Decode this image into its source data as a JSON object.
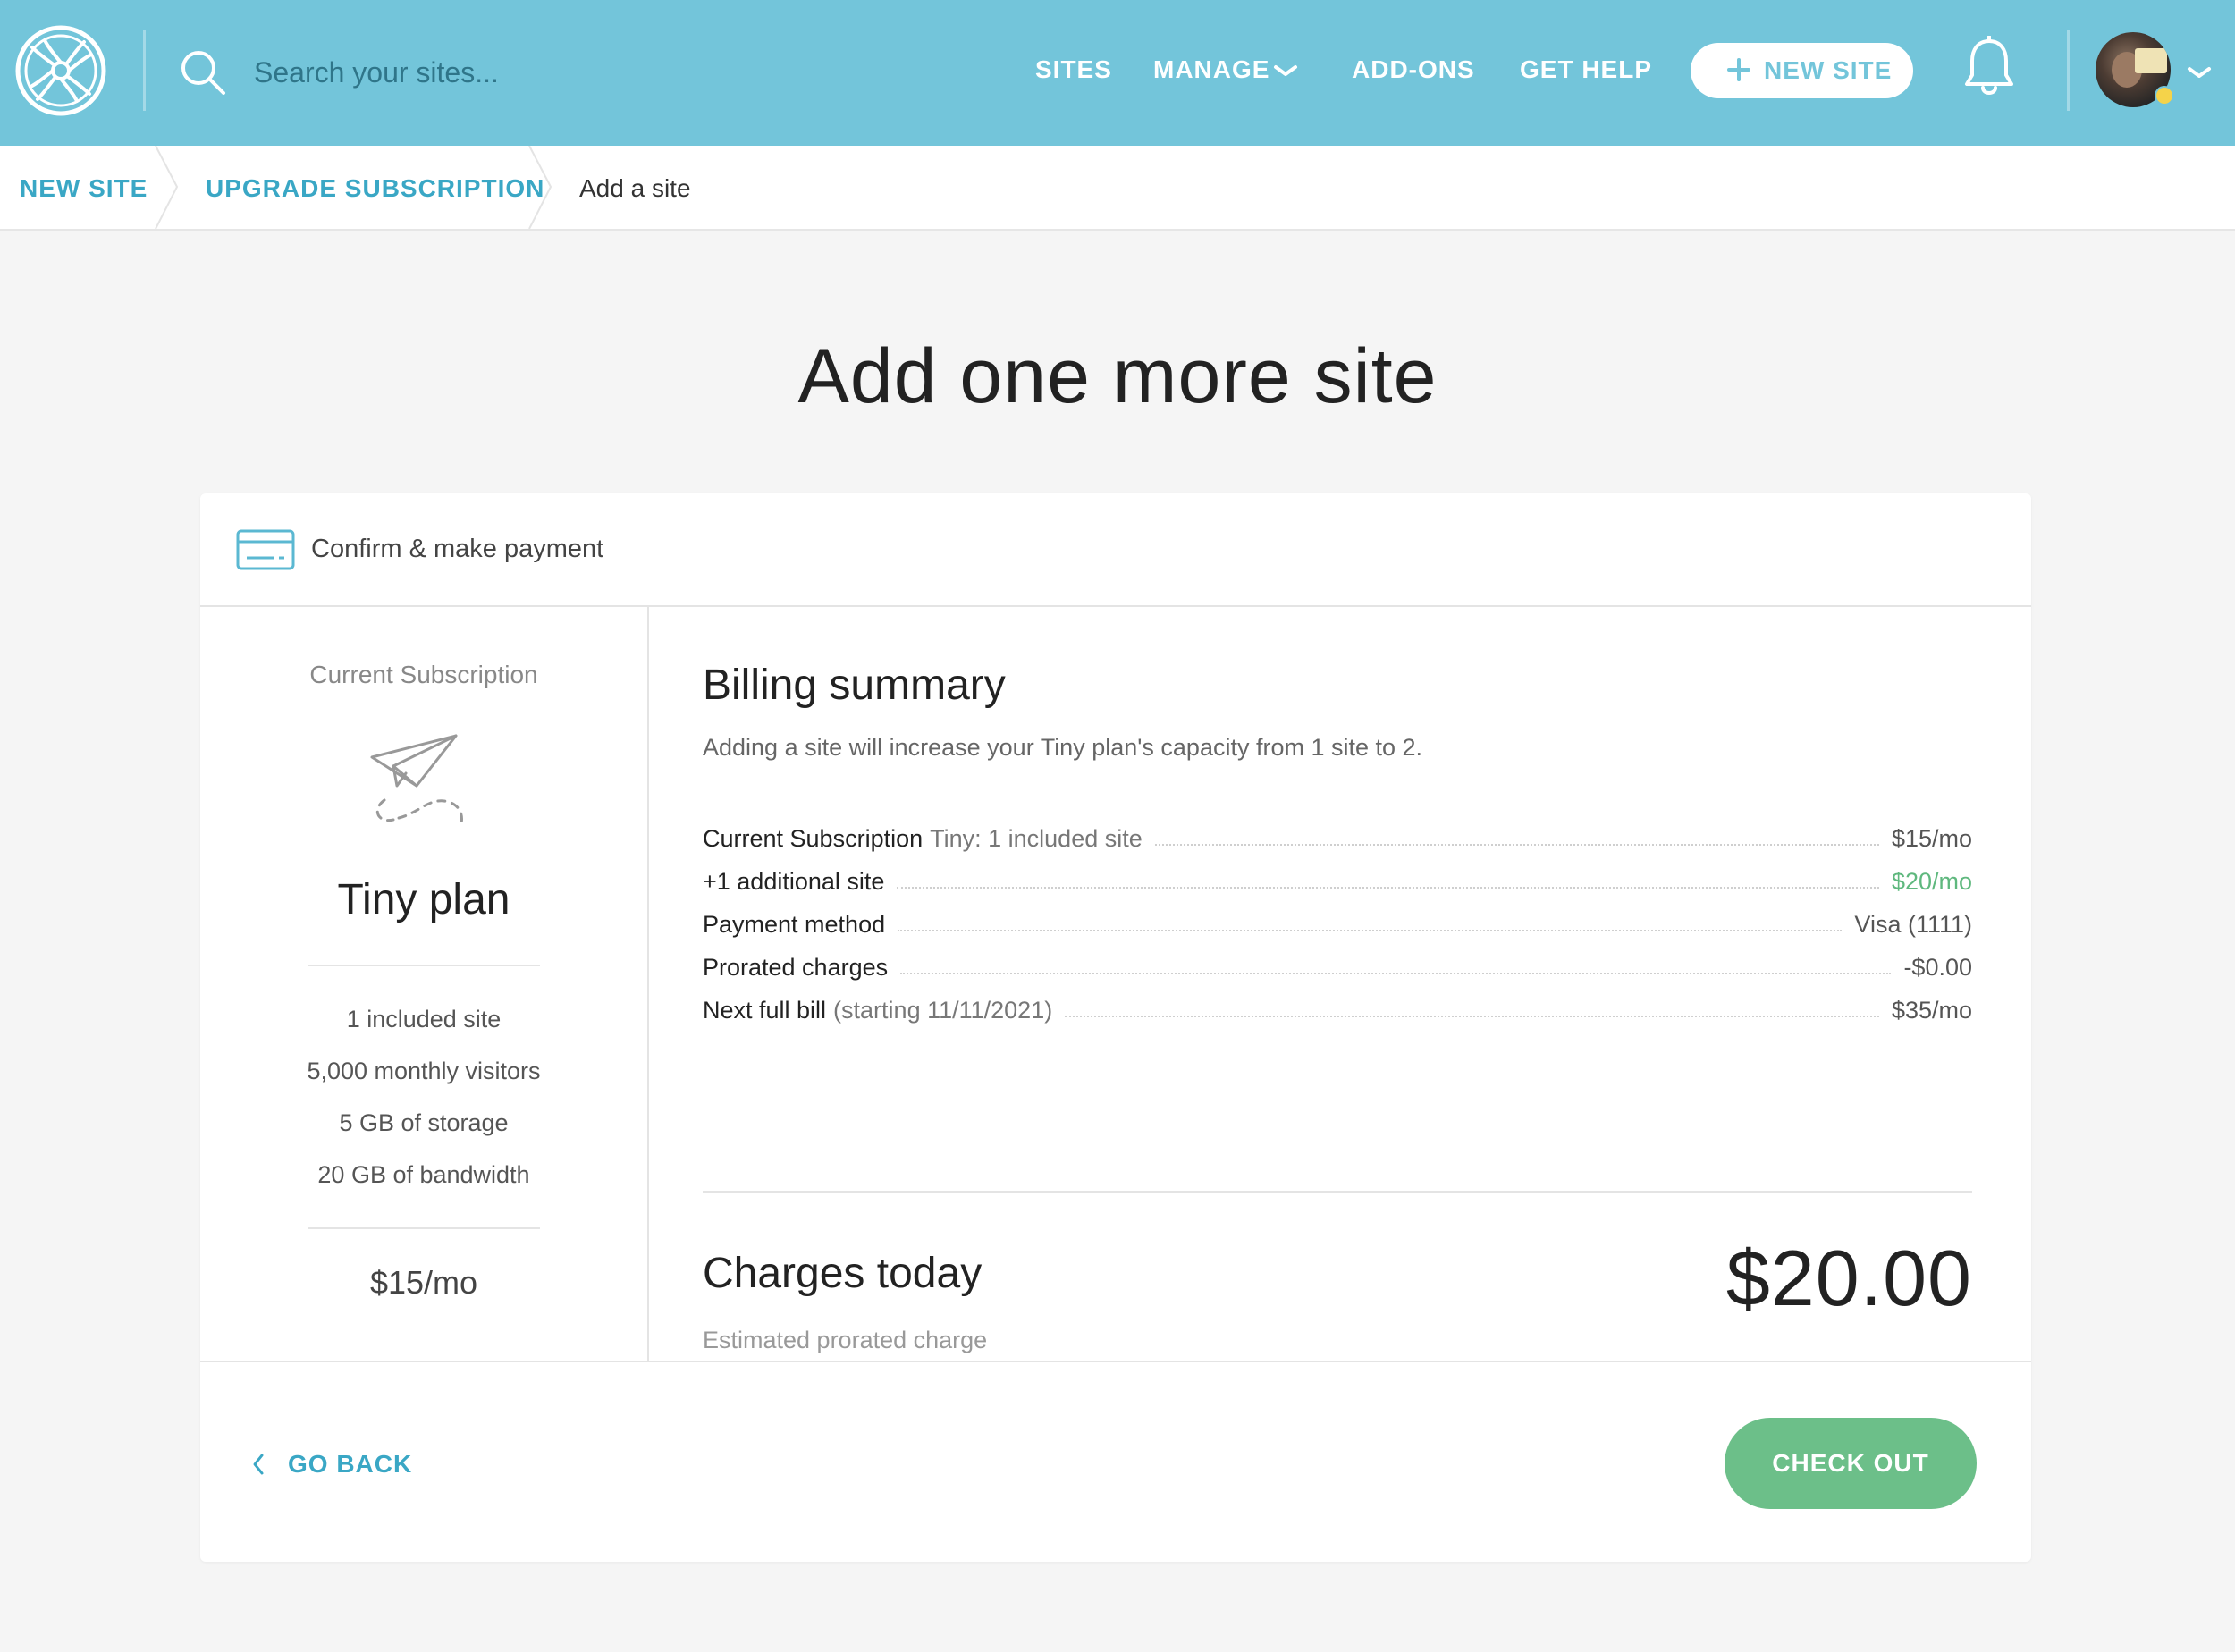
{
  "header": {
    "search": {
      "placeholder": "Search your sites..."
    },
    "nav": {
      "sites": "SITES",
      "manage": "MANAGE",
      "addons": "ADD-ONS",
      "help": "GET HELP"
    },
    "new_site_button": "NEW SITE"
  },
  "breadcrumb": {
    "items": [
      "NEW SITE",
      "UPGRADE SUBSCRIPTION",
      "Add a site"
    ]
  },
  "page_title": "Add one more site",
  "card": {
    "header_title": "Confirm & make payment"
  },
  "subscription": {
    "label": "Current Subscription",
    "plan_name": "Tiny plan",
    "features": [
      "1 included site",
      "5,000 monthly visitors",
      "5 GB of storage",
      "20 GB of bandwidth"
    ],
    "price": "$15/mo"
  },
  "billing": {
    "title": "Billing summary",
    "description": "Adding a site will increase your Tiny plan's capacity from 1 site to 2.",
    "rows": [
      {
        "label": "Current Subscription",
        "note": "Tiny: 1 included site",
        "value": "$15/mo"
      },
      {
        "label": "+1 additional site",
        "note": "",
        "value": "$20/mo"
      },
      {
        "label": "Payment method",
        "note": "",
        "value": "Visa (1111)"
      },
      {
        "label": "Prorated charges",
        "note": "",
        "value": "-$0.00"
      },
      {
        "label": "Next full bill",
        "note": "(starting 11/11/2021)",
        "value": "$35/mo"
      }
    ],
    "highlight_color": "#5fb87e"
  },
  "charges_today": {
    "title": "Charges today",
    "subtitle": "Estimated prorated charge",
    "amount": "$20.00"
  },
  "footer": {
    "go_back": "GO BACK",
    "checkout": "CHECK OUT"
  },
  "colors": {
    "header_bg": "#73c5da",
    "link": "#3aa7c5",
    "checkout": "#6cbf89"
  },
  "icons": {
    "logo": "flywheel-logo-icon",
    "search": "search-icon",
    "manage_chevron": "chevron-down-icon",
    "plus": "plus-icon",
    "bell": "bell-icon",
    "account_chevron": "chevron-down-icon",
    "card": "credit-card-icon",
    "plan": "paper-plane-icon",
    "back": "chevron-left-icon"
  }
}
